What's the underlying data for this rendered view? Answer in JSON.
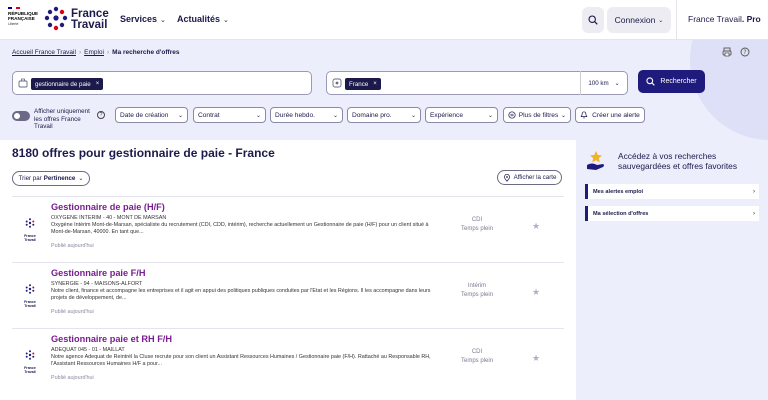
{
  "header": {
    "rf_logo": {
      "title_lines": [
        "RÉPUBLIQUE",
        "FRANÇAISE"
      ],
      "motto_lines": [
        "Liberté",
        "Égalité",
        "Fraternité"
      ]
    },
    "brand": {
      "line1": "France",
      "line2": "Travail"
    },
    "nav": [
      {
        "label": "Services"
      },
      {
        "label": "Actualités"
      }
    ],
    "search_icon": "search-icon",
    "connexion_label": "Connexion",
    "pro_label_prefix": "France Travail",
    "pro_label_suffix": ". Pro",
    "chevron": "⌄"
  },
  "breadcrumb": {
    "items": [
      "Accueil France Travail",
      "Emploi"
    ],
    "current": "Ma recherche d'offres"
  },
  "search": {
    "keyword_chip": "gestionnaire de paie",
    "location_chip": "France",
    "distance": "100 km",
    "submit_label": "Rechercher",
    "chip_remove": "×"
  },
  "filters": {
    "toggle_label": "Afficher uniquement les offres France Travail",
    "help": "?",
    "items": [
      {
        "label": "Date de création"
      },
      {
        "label": "Contrat"
      },
      {
        "label": "Durée hebdo."
      },
      {
        "label": "Domaine pro."
      },
      {
        "label": "Expérience"
      },
      {
        "label": "Plus de filtres"
      }
    ],
    "alert_label": "Créer une alerte"
  },
  "results": {
    "count": "8180 offres",
    "query_text": "pour gestionnaire de paie - France",
    "sort_prefix": "Trier par",
    "sort_value": "Pertinence",
    "map_label": "Afficher la carte"
  },
  "offers": [
    {
      "title": "Gestionnaire de paie (H/F)",
      "company": "OXYGENE INTERIM - 40 - MONT DE MARSAN",
      "desc": "Oxygène Intérim Mont-de-Marsan, spécialiste du recrutement (CDI, CDD, intérim), recherche actuellement un Gestionnaire de paie (H/F) pour un client situé à Mont-de-Marsan, 40000. En tant que...",
      "published": "Publié aujourd'hui",
      "contract": "CDI",
      "time": "Temps plein",
      "logo_text": "France Travail"
    },
    {
      "title": "Gestionnaire paie F/H",
      "company": "SYNERGIE - 94 - MAISONS-ALFORT",
      "desc": "Notre client, finance et accompagne les entreprises et il agit en appui des politiques publiques conduites par l'Etat et les Régions. Il les accompagne dans leurs projets de développement, de...",
      "published": "Publié aujourd'hui",
      "contract": "Intérim",
      "time": "Temps plein",
      "logo_text": "France Travail"
    },
    {
      "title": "Gestionnaire paie et RH F/H",
      "company": "ADEQUAT 045 - 01 - MAILLAT",
      "desc": "Notre agence Adequat de Reintrél la Cluse recrute pour son client un Assistant Ressources Humaines / Gestionnaire paie (F/H). Rattaché au Responsable RH, l'Assistant Ressources Humaines H/F a pour...",
      "published": "Publié aujourd'hui",
      "contract": "CDI",
      "time": "Temps plein",
      "logo_text": "France Travail"
    }
  ],
  "sidebar": {
    "title": "Accédez à vos recherches sauvegardées et offres favorites",
    "links": [
      {
        "label": "Mes alertes emploi"
      },
      {
        "label": "Ma sélection d'offres"
      }
    ],
    "chevron": "›"
  },
  "colors": {
    "brand_navy": "#1b1a4a",
    "accent_blue": "#1f1b7c",
    "offer_title": "#7a1d92",
    "band_bg": "#eceefb"
  }
}
